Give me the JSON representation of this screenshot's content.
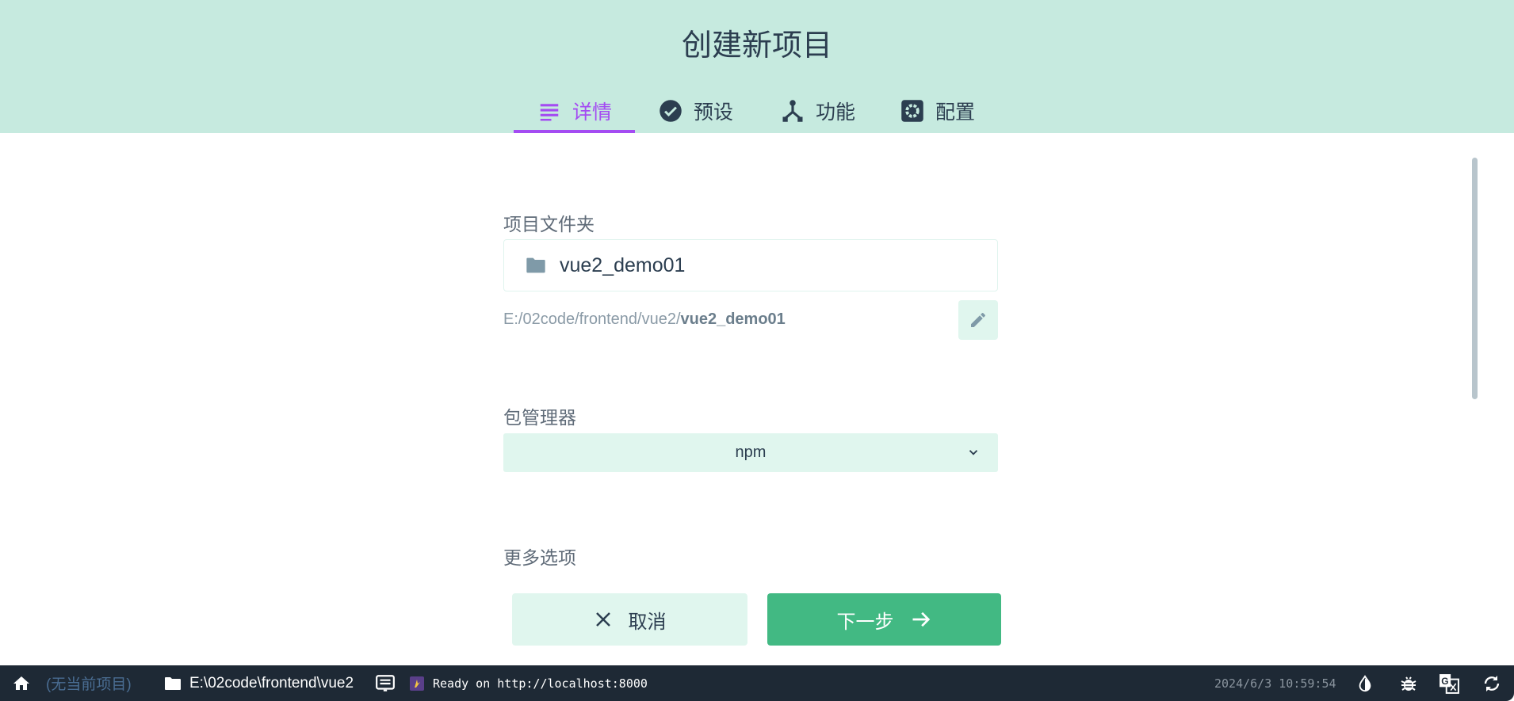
{
  "header": {
    "title": "创建新项目",
    "tabs": [
      {
        "label": "详情",
        "icon": "list-icon",
        "active": true
      },
      {
        "label": "预设",
        "icon": "check-circle-icon"
      },
      {
        "label": "功能",
        "icon": "fork-icon"
      },
      {
        "label": "配置",
        "icon": "gear-icon"
      }
    ]
  },
  "form": {
    "folder_label": "项目文件夹",
    "folder_value": "vue2_demo01",
    "path_prefix": "E:/02code/frontend/vue2/",
    "path_name": "vue2_demo01",
    "pm_label": "包管理器",
    "pm_value": "npm",
    "more_label": "更多选项",
    "cancel_label": "取消",
    "next_label": "下一步"
  },
  "statusbar": {
    "no_project": "(无当前项目)",
    "cwd": "E:\\02code\\frontend\\vue2",
    "log": "Ready on http://localhost:8000",
    "datetime": "2024/6/3 10:59:54"
  },
  "colors": {
    "accent": "#a44cf2",
    "primary": "#42b983",
    "header_bg": "#c6eadf",
    "statusbar_bg": "#1e2935"
  }
}
